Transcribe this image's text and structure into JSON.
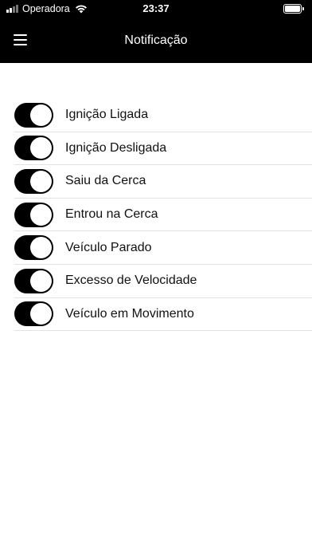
{
  "status_bar": {
    "carrier": "Operadora",
    "time": "23:37",
    "icons": [
      "signal-icon",
      "wifi-icon",
      "battery-icon"
    ]
  },
  "nav": {
    "title": "Notificação",
    "menu_icon": "hamburger-menu-icon"
  },
  "colors": {
    "bar_background": "#000000",
    "toggle_on": "#000000",
    "separator": "#e3e3e3"
  },
  "notifications": [
    {
      "label": "Ignição Ligada",
      "enabled": true
    },
    {
      "label": "Ignição Desligada",
      "enabled": true
    },
    {
      "label": "Saiu da Cerca",
      "enabled": true
    },
    {
      "label": "Entrou na Cerca",
      "enabled": true
    },
    {
      "label": "Veículo Parado",
      "enabled": true
    },
    {
      "label": "Excesso de Velocidade",
      "enabled": true
    },
    {
      "label": "Veículo em Movimento",
      "enabled": true
    }
  ]
}
